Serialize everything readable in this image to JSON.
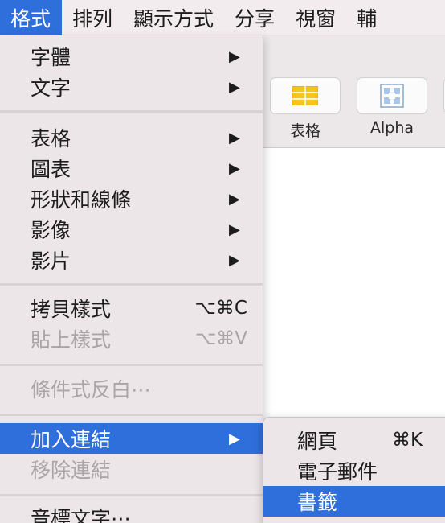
{
  "menubar": {
    "items": [
      {
        "label": "格式"
      },
      {
        "label": "排列"
      },
      {
        "label": "顯示方式"
      },
      {
        "label": "分享"
      },
      {
        "label": "視窗"
      },
      {
        "label": "輔"
      }
    ]
  },
  "toolbar": {
    "table_label": "表格",
    "alpha_label": "Alpha"
  },
  "format_menu": {
    "font": "字體",
    "text": "文字",
    "table": "表格",
    "chart": "圖表",
    "shapes": "形狀和線條",
    "image": "影像",
    "movie": "影片",
    "copy_style": "拷貝樣式",
    "copy_style_shortcut": "⌥⌘C",
    "paste_style": "貼上樣式",
    "paste_style_shortcut": "⌥⌘V",
    "conditional": "條件式反白⋯",
    "add_link": "加入連結",
    "remove_link": "移除連結",
    "phonetic": "音標文字⋯",
    "arrow": "▶"
  },
  "link_submenu": {
    "webpage": "網頁",
    "webpage_shortcut": "⌘K",
    "email": "電子郵件",
    "bookmark": "書籤"
  },
  "colors": {
    "highlight": "#2f6fdc",
    "menu_bg": "#ece6e8"
  }
}
